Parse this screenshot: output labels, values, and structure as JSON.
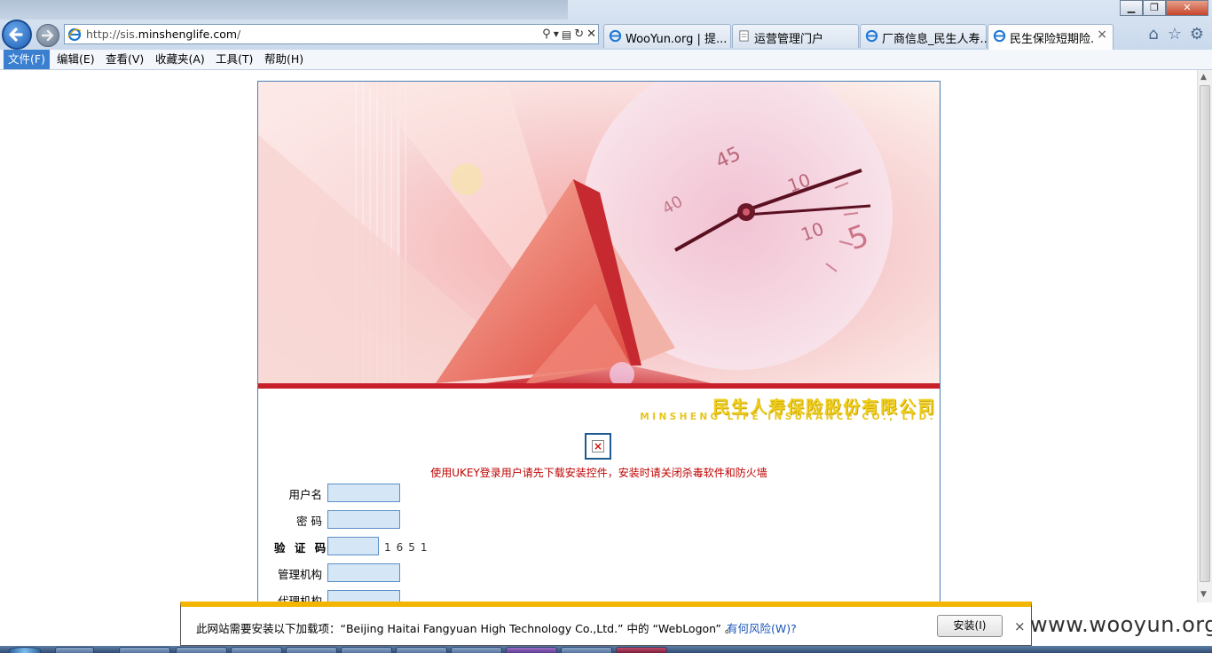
{
  "browser": {
    "address": {
      "url_prefix": "http://sis.",
      "url_domain": "minshenglife.com",
      "url_suffix": "/"
    },
    "tabs": [
      {
        "label": "WooYun.org | 提..."
      },
      {
        "label": "运营管理门户"
      },
      {
        "label": "厂商信息_民生人寿..."
      },
      {
        "label": "民生保险短期险..."
      }
    ],
    "window_controls": {
      "minimize": "▁",
      "restore": "❐",
      "close": "✕"
    }
  },
  "menu": {
    "items": [
      {
        "label": "文件(F)"
      },
      {
        "label": "编辑(E)"
      },
      {
        "label": "查看(V)"
      },
      {
        "label": "收藏夹(A)"
      },
      {
        "label": "工具(T)"
      },
      {
        "label": "帮助(H)"
      }
    ]
  },
  "page": {
    "brand_cn": "民生人寿保险股份有限公司",
    "brand_en": "MINSHENG LIFE INSURANCE CO., LTD.",
    "ukey_notice": "使用UKEY登录用户请先下载安装控件，安装时请关闭杀毒软件和防火墙",
    "form": {
      "username_label": "用户名",
      "password_label": "密 码",
      "captcha_label": "验 证 码",
      "captcha_code": "1651",
      "org_label": "管理机构",
      "agent_label": "代理机构"
    }
  },
  "notification": {
    "message": "此网站需要安装以下加载项：“Beijing Haitai Fangyuan High Technology Co.,Ltd.” 中的 “WebLogon” 。",
    "risk_link": "有何风险(W)?",
    "install_button": "安装(I)",
    "close": "×"
  },
  "watermark": "www.wooyun.org",
  "colors": {
    "accent": "#3a7fd0",
    "warning_bar": "#f3b500",
    "brand_gold": "#f0cf1e",
    "notice_red": "#c00000",
    "banner_red": "#c8202a"
  }
}
